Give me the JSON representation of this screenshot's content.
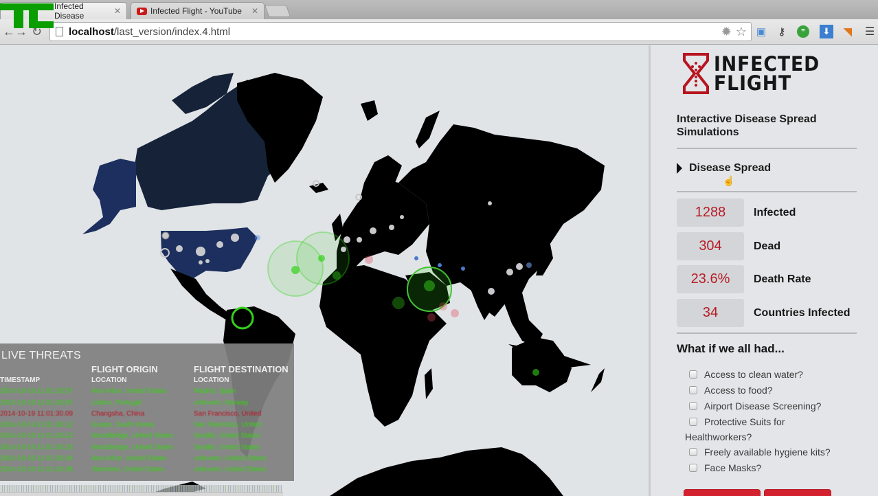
{
  "browser": {
    "tabs": [
      {
        "label": "Infected Disease",
        "active": true
      },
      {
        "label": "Infected Flight - YouTube",
        "active": false
      }
    ],
    "address": {
      "host": "localhost",
      "path": "/last_version/index.4.html"
    },
    "extensions": [
      "settings-gear-icon",
      "bookmark-star-icon",
      "folder-icon",
      "key-icon",
      "hangouts-icon",
      "download-icon",
      "rss-icon",
      "menu-icon"
    ],
    "watermark": "TC"
  },
  "map": {
    "colors": {
      "ocean": "#e1e4e7",
      "land": "#000000",
      "highlight_us": "#1c2f5e",
      "highlight_canada": "#152238",
      "infection_green": "#33d11a",
      "infection_red": "#e0485a",
      "airport_grey": "#c8c8cc",
      "flight_blue": "#4a7ac8"
    }
  },
  "threats": {
    "title": "LIVE THREATS",
    "headers": {
      "timestamp": "TIMESTAMP",
      "origin_group": "FLIGHT ORIGIN",
      "origin": "LOCATION",
      "destination_group": "FLIGHT DESTINATION",
      "destination": "LOCATION"
    },
    "rows": [
      {
        "timestamp": "2014-10-19 11:01:29.57",
        "origin": "Ann Arbor, United States",
        "destination": "Madrid, Spain",
        "status": "green"
      },
      {
        "timestamp": "2014-10-19 11:01:29.87",
        "origin": "Lisbon, Portugal",
        "destination": "unknown, Norway",
        "status": "green"
      },
      {
        "timestamp": "2014-10-19 11:01:30.09",
        "origin": "Changsha, China",
        "destination": "San Francisco, United",
        "status": "red"
      },
      {
        "timestamp": "2014-10-19 11:01:30.12",
        "origin": "Gunpo, South Korea",
        "destination": "San Francisco, United",
        "status": "green"
      },
      {
        "timestamp": "2014-10-19 11:01:30.22",
        "origin": "Woodbridge, United States",
        "destination": "Seattle, United States",
        "status": "green"
      },
      {
        "timestamp": "2014-10-19 11:01:30.23",
        "origin": "Woodbridge, United States",
        "destination": "Seattle, United States",
        "status": "green"
      },
      {
        "timestamp": "2014-10-19 11:01:30.34",
        "origin": "Ann Arbor, United States",
        "destination": "unknown, United States",
        "status": "green"
      },
      {
        "timestamp": "2014-10-19 11:01:30.36",
        "origin": "Stamford, United States",
        "destination": "unknown, United States",
        "status": "green"
      }
    ],
    "status_colors": {
      "green": "#35d40f",
      "red": "#b8141f"
    }
  },
  "sidebar": {
    "logo": {
      "line1": "INFECTED",
      "line2": "FLIGHT",
      "accent": "#b8141f"
    },
    "subtitle": "Interactive Disease Spread Simulations",
    "section": "Disease Spread",
    "stats": [
      {
        "value": "1288",
        "label": "Infected"
      },
      {
        "value": "304",
        "label": "Dead"
      },
      {
        "value": "23.6%",
        "label": "Death Rate"
      },
      {
        "value": "34",
        "label": "Countries Infected"
      }
    ],
    "whatif_title": "What if we all had...",
    "options": [
      {
        "label": "Access to clean water?",
        "checked": false
      },
      {
        "label": "Access to food?",
        "checked": false
      },
      {
        "label": "Airport Disease Screening?",
        "checked": false
      },
      {
        "label": "Protective Suits for",
        "label_cont": "Healthworkers?",
        "checked": false
      },
      {
        "label": "Freely available hygiene kits?",
        "checked": false
      },
      {
        "label": "Face Masks?",
        "checked": false
      }
    ],
    "button_color": "#d3212f"
  }
}
